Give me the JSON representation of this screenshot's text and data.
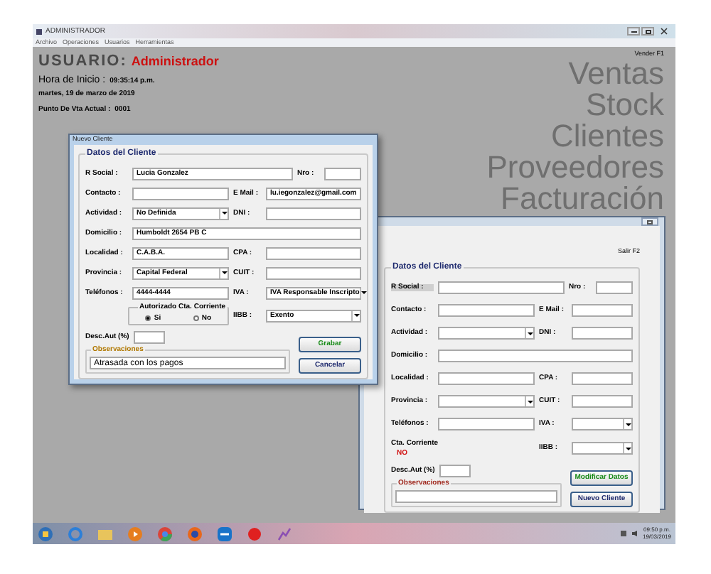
{
  "window": {
    "title": "ADMINISTRADOR",
    "menu": [
      "Archivo",
      "Operaciones",
      "Usuarios",
      "Herramientas"
    ]
  },
  "header": {
    "user_label": "USUARIO:",
    "user_name": "Administrador",
    "start_label": "Hora de Inicio :",
    "start_time": "09:35:14 p.m.",
    "date": "martes, 19 de marzo de 2019",
    "pos_label": "Punto De Vta Actual :",
    "pos_value": "0001",
    "shortcut": "Vender F1"
  },
  "nav": [
    "Ventas",
    "Stock",
    "Clientes",
    "Proveedores",
    "Facturación"
  ],
  "client_window": {
    "active": false,
    "shortcut": "Salir F2",
    "group": "Datos del Cliente",
    "rows": [
      [
        {
          "kind": "text",
          "label": "R Social :",
          "disabled": true
        },
        {
          "kind": "text",
          "label": "Nro :"
        }
      ],
      [
        {
          "kind": "text",
          "label": "Contacto :"
        },
        {
          "kind": "text",
          "label": "E Mail :"
        }
      ],
      [
        {
          "kind": "select",
          "label": "Actividad :"
        },
        {
          "kind": "text",
          "label": "DNI :"
        }
      ],
      [
        {
          "kind": "text",
          "label": "Domicilio :"
        }
      ],
      [
        {
          "kind": "text",
          "label": "Localidad :"
        },
        {
          "kind": "text",
          "label": "CPA :"
        }
      ],
      [
        {
          "kind": "select",
          "label": "Provincia :"
        },
        {
          "kind": "text",
          "label": "CUIT :"
        }
      ],
      [
        {
          "kind": "text",
          "label": "Teléfonos :"
        },
        {
          "kind": "select",
          "label": "IVA :"
        }
      ],
      [
        {
          "kind": "status",
          "label": "Cta. Corriente",
          "value": "NO"
        },
        {
          "kind": "select",
          "label": "IIBB :"
        }
      ]
    ],
    "desc": {
      "label": "Desc.Aut (%)"
    },
    "notes": {
      "label": "Observaciones"
    },
    "buttons": [
      {
        "kind": "confirm",
        "label": "Modificar Datos"
      },
      {
        "kind": "normal",
        "label": "Nuevo Cliente"
      }
    ]
  },
  "new_client": {
    "active": true,
    "title": "Nuevo Cliente",
    "group": "Datos del Cliente",
    "rows": [
      [
        {
          "kind": "text",
          "label": "R Social :",
          "value": "Lucia Gonzalez"
        },
        {
          "kind": "text",
          "label": "Nro :"
        }
      ],
      [
        {
          "kind": "text",
          "label": "Contacto :"
        },
        {
          "kind": "text",
          "label": "E Mail :",
          "value": "lu.iegonzalez@gmail.com"
        }
      ],
      [
        {
          "kind": "select",
          "label": "Actividad :",
          "value": "No Definida"
        },
        {
          "kind": "text",
          "label": "DNI :"
        }
      ],
      [
        {
          "kind": "text",
          "label": "Domicilio :",
          "value": "Humboldt 2654 PB C"
        }
      ],
      [
        {
          "kind": "text",
          "label": "Localidad :",
          "value": "C.A.B.A."
        },
        {
          "kind": "text",
          "label": "CPA :"
        }
      ],
      [
        {
          "kind": "select",
          "label": "Provincia :",
          "value": "Capital Federal"
        },
        {
          "kind": "text",
          "label": "CUIT :"
        }
      ],
      [
        {
          "kind": "text",
          "label": "Teléfonos :",
          "value": "4444-4444"
        },
        {
          "kind": "select",
          "label": "IVA :",
          "value": "IVA Responsable Inscripto"
        }
      ],
      [
        {
          "kind": "radio",
          "label": "Autorizado Cta. Corriente",
          "options": [
            {
              "label": "Si",
              "selected": true
            },
            {
              "label": "No",
              "selected": false
            }
          ]
        },
        {
          "kind": "select",
          "label": "IIBB :",
          "value": "Exento"
        }
      ]
    ],
    "desc": {
      "label": "Desc.Aut (%)"
    },
    "notes": {
      "label": "Observaciones",
      "value": "Atrasada con los pagos"
    },
    "buttons": [
      {
        "kind": "confirm",
        "label": "Grabar"
      },
      {
        "kind": "normal",
        "label": "Cancelar"
      }
    ]
  },
  "taskbar": {
    "time": "09:50 p.m.",
    "date": "19/03/2019"
  }
}
